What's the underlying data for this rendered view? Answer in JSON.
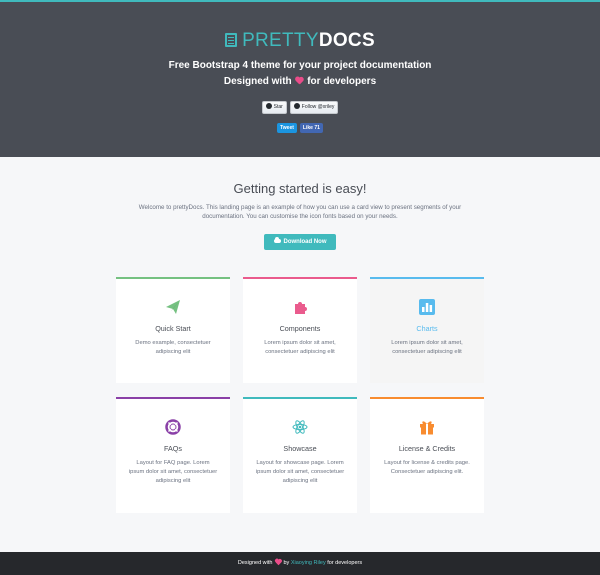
{
  "header": {
    "brand_pretty": "PRETTY",
    "brand_docs": "DOCS",
    "tagline_line1": "Free Bootstrap 4 theme for your project documentation",
    "tagline_line2_prefix": "Designed with",
    "tagline_line2_suffix": "for developers",
    "github_star_label": "Star",
    "github_follow_label": "Follow @xriley",
    "tweet_label": "Tweet",
    "fb_like_label": "Like 71"
  },
  "intro": {
    "title": "Getting started is easy!",
    "text": "Welcome to prettyDocs. This landing page is an example of how you can use a card view to present segments of your documentation. You can customise the icon fonts based on your needs.",
    "download_label": "Download Now"
  },
  "cards": [
    {
      "title": "Quick Start",
      "desc": "Demo example, consectetuer adipiscing elit",
      "icon": "paper-plane-icon",
      "color": "#75c181"
    },
    {
      "title": "Components",
      "desc": "Lorem ipsum dolor sit amet, consectetuer adipiscing elit",
      "icon": "puzzle-piece-icon",
      "color": "#ea5b8d"
    },
    {
      "title": "Charts",
      "desc": "Lorem ipsum dolor sit amet, consectetuer adipiscing elit",
      "icon": "bar-chart-icon",
      "color": "#58bbee"
    },
    {
      "title": "FAQs",
      "desc": "Layout for FAQ page. Lorem ipsum dolor sit amet, consectetuer adipiscing elit",
      "icon": "life-ring-icon",
      "color": "#8a40a7"
    },
    {
      "title": "Showcase",
      "desc": "Layout for showcase page. Lorem ipsum dolor sit amet, consectetuer adipiscing elit",
      "icon": "atom-icon",
      "color": "#40babd"
    },
    {
      "title": "License & Credits",
      "desc": "Layout for license & credits page. Consectetuer adipiscing elit.",
      "icon": "gift-icon",
      "color": "#f88c30"
    }
  ],
  "footer": {
    "prefix": "Designed with",
    "by": "by",
    "author": "Xiaoying Riley",
    "suffix": "for developers"
  }
}
